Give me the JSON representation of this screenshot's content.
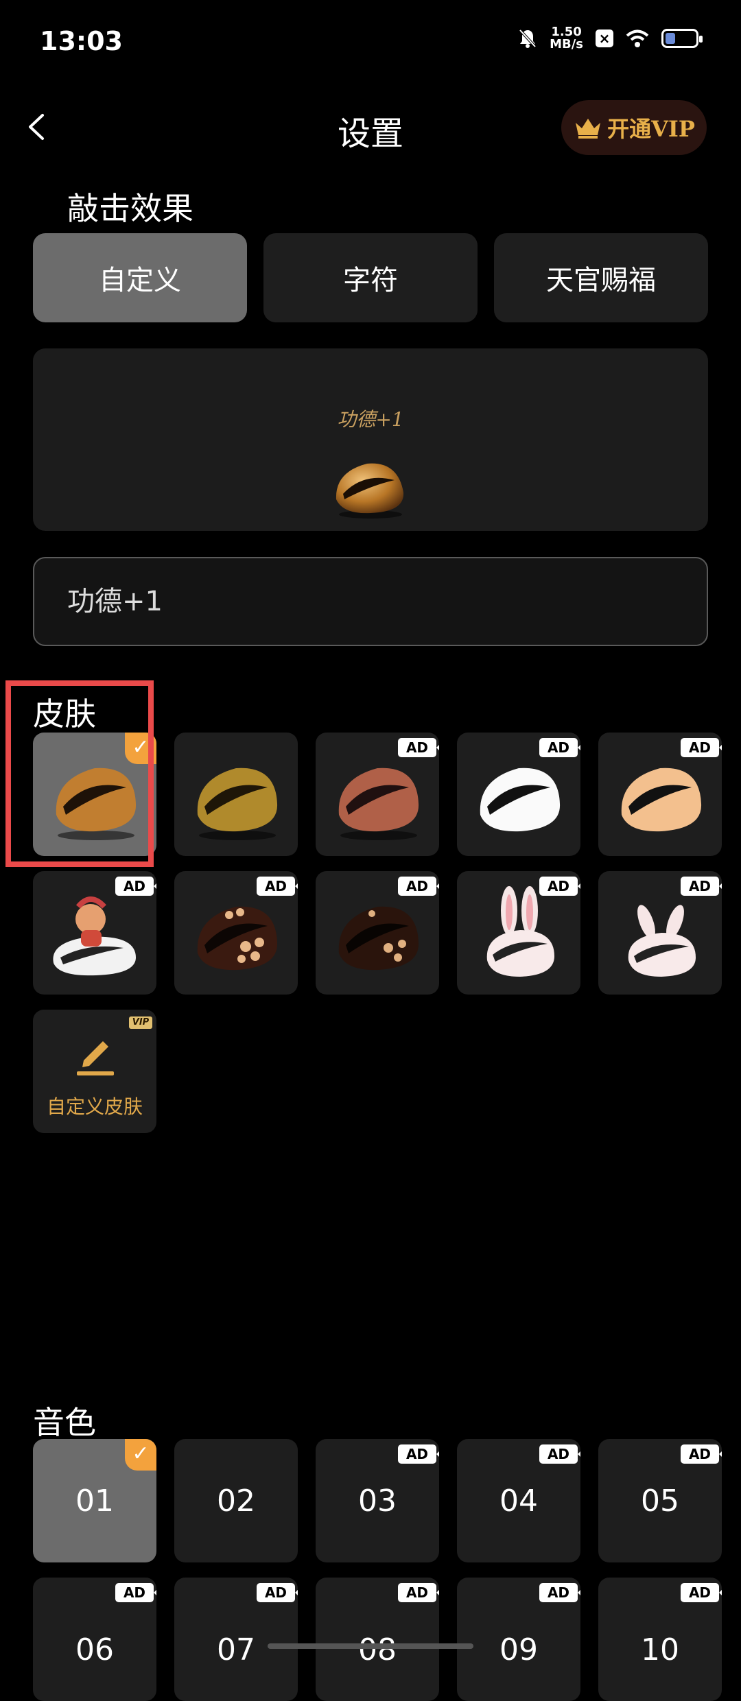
{
  "status_bar": {
    "time": "13:03",
    "net_speed_value": "1.50",
    "net_speed_unit": "MB/s",
    "badge": "×"
  },
  "header": {
    "title": "设置",
    "vip_label": "开通VIP"
  },
  "effects": {
    "title": "敲击效果",
    "tabs": [
      {
        "label": "自定义",
        "active": true
      },
      {
        "label": "字符",
        "active": false
      },
      {
        "label": "天官赐福",
        "active": false
      }
    ],
    "preview_text": "功德+1",
    "input_value": "功德+1"
  },
  "skins": {
    "title": "皮肤",
    "items": [
      {
        "icon": "wooden-fish-brown-icon",
        "badge": "check",
        "selected": true
      },
      {
        "icon": "wooden-fish-gold-icon",
        "badge": ""
      },
      {
        "icon": "wooden-fish-red-icon",
        "badge": "AD"
      },
      {
        "icon": "wooden-fish-white-icon",
        "badge": "AD"
      },
      {
        "icon": "wooden-fish-peach-icon",
        "badge": "AD"
      },
      {
        "icon": "dragon-fish-icon",
        "badge": "AD"
      },
      {
        "icon": "spotted-fish-icon",
        "badge": "AD"
      },
      {
        "icon": "spotted-fish-dark-icon",
        "badge": "AD"
      },
      {
        "icon": "rabbit-fish-icon",
        "badge": "AD"
      },
      {
        "icon": "rabbit-fish-small-icon",
        "badge": "AD"
      }
    ],
    "custom_label": "自定义皮肤",
    "custom_tag": "VIP",
    "ad_label": "AD"
  },
  "sounds": {
    "title": "音色",
    "items": [
      "01",
      "02",
      "03",
      "04",
      "05",
      "06",
      "07",
      "08",
      "09",
      "10"
    ]
  },
  "colors": {
    "accent": "#f3a23d",
    "vip_gold": "#e8b04a",
    "tile_bg": "#1e1e1e",
    "selected_bg": "#6c6c6c",
    "highlight": "#ea4a4a"
  }
}
